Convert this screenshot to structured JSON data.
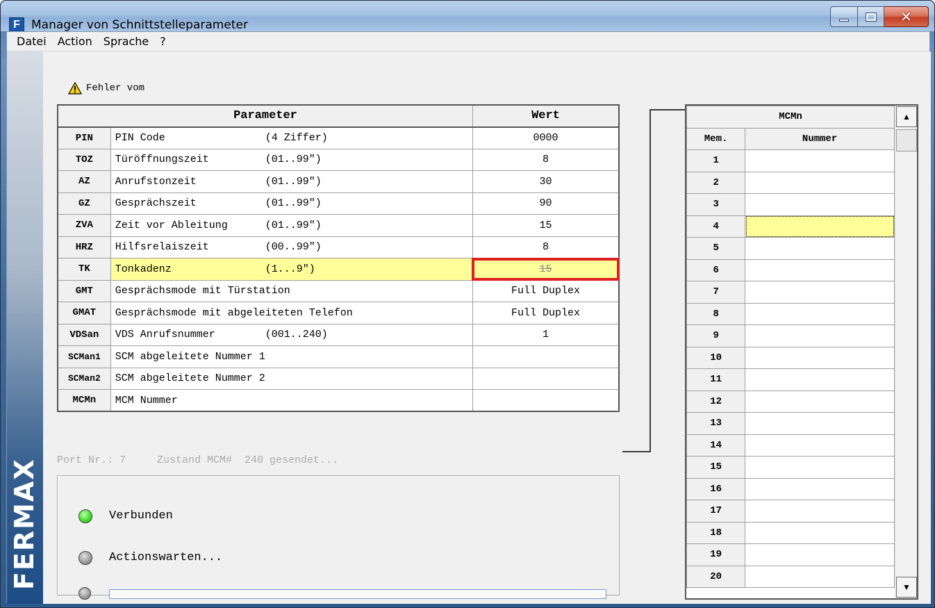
{
  "window": {
    "title": "Manager von Schnittstelleparameter",
    "app_icon_letter": "F"
  },
  "menu": [
    "Datei",
    "Action",
    "Sprache",
    "?"
  ],
  "brand": "FERMAX",
  "warning": "Fehler vom",
  "parameters": {
    "headers": {
      "parameter": "Parameter",
      "value": "Wert"
    },
    "rows": [
      {
        "code": "PIN",
        "desc": "PIN Code                (4 Ziffer)",
        "value": "0000"
      },
      {
        "code": "TOZ",
        "desc": "Türöffnungszeit         (01..99\")",
        "value": "8"
      },
      {
        "code": "AZ",
        "desc": "Anrufstonzeit           (01..99\")",
        "value": "30"
      },
      {
        "code": "GZ",
        "desc": "Gesprächszeit           (01..99\")",
        "value": "90"
      },
      {
        "code": "ZVA",
        "desc": "Zeit vor Ableitung      (01..99\")",
        "value": "15"
      },
      {
        "code": "HRZ",
        "desc": "Hilfsrelaiszeit         (00..99\")",
        "value": "8"
      },
      {
        "code": "TK",
        "desc": "Tonkadenz               (1...9\")",
        "value": "15"
      },
      {
        "code": "GMT",
        "desc": "Gesprächsmode mit Türstation",
        "value": "Full Duplex"
      },
      {
        "code": "GMAT",
        "desc": "Gesprächsmode mit abgeleiteten Telefon",
        "value": "Full Duplex"
      },
      {
        "code": "VDSan",
        "desc": "VDS Anrufsnummer        (001..240)",
        "value": "1"
      },
      {
        "code": "SCMan1",
        "desc": "SCM abgeleitete Nummer 1",
        "value": ""
      },
      {
        "code": "SCMan2",
        "desc": "SCM abgeleitete Nummer 2",
        "value": ""
      },
      {
        "code": "MCMn",
        "desc": "MCM Nummer",
        "value": ""
      }
    ]
  },
  "mcm": {
    "title": "MCMn",
    "col_mem": "Mem.",
    "col_num": "Nummer",
    "rows": [
      "1",
      "2",
      "3",
      "4",
      "5",
      "6",
      "7",
      "8",
      "9",
      "10",
      "11",
      "12",
      "13",
      "14",
      "15",
      "16",
      "17",
      "18",
      "19",
      "20"
    ]
  },
  "status_line": "Port Nr.: 7     Zustand MCM#  240 gesendet...",
  "indicators": {
    "connected": "Verbunden",
    "waiting": "Actionswarten..."
  },
  "colors": {
    "highlight": "#ffff99",
    "error_border": "#e02020",
    "led_green": "#3adb23",
    "led_gray": "#9a9a9a"
  }
}
